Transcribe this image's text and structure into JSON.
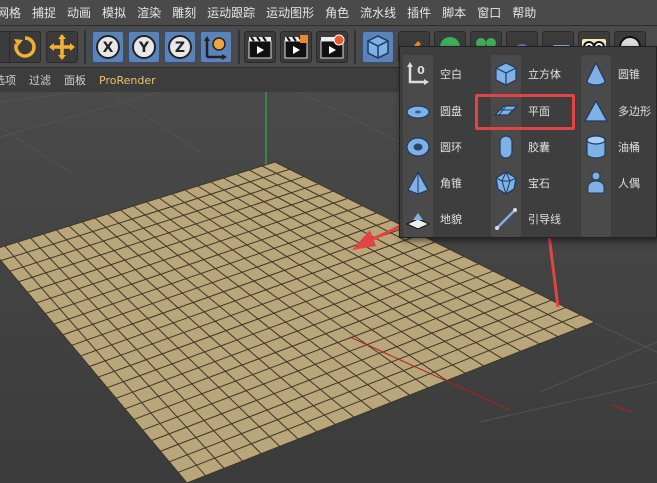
{
  "menu": [
    "网格",
    "捕捉",
    "动画",
    "模拟",
    "渲染",
    "雕刻",
    "运动跟踪",
    "运动图形",
    "角色",
    "流水线",
    "插件",
    "脚本",
    "窗口",
    "帮助"
  ],
  "viewport_menu": [
    "选项",
    "过滤",
    "面板",
    "ProRender"
  ],
  "toolbar": {
    "icons": [
      "rotate-icon",
      "move-icon",
      "x-axis-icon",
      "y-axis-icon",
      "z-axis-icon",
      "world-coordinate-icon",
      "render-view-icon",
      "render-picture-viewer-icon",
      "render-settings-icon",
      "cube-icon",
      "pen-icon",
      "subdivision-icon",
      "cloner-icon",
      "deformer-icon",
      "scene-icon",
      "camera-icon",
      "light-icon"
    ],
    "axis_x": "X",
    "axis_y": "Y",
    "axis_z": "Z"
  },
  "panel": {
    "columns": [
      [
        {
          "label": "空白",
          "icon": "null-object-icon"
        },
        {
          "label": "圆盘",
          "icon": "disc-icon"
        },
        {
          "label": "圆环",
          "icon": "torus-icon"
        },
        {
          "label": "角锥",
          "icon": "pyramid-icon"
        },
        {
          "label": "地貌",
          "icon": "landscape-icon"
        }
      ],
      [
        {
          "label": "立方体",
          "icon": "cube-icon"
        },
        {
          "label": "平面",
          "icon": "plane-icon"
        },
        {
          "label": "胶囊",
          "icon": "capsule-icon"
        },
        {
          "label": "宝石",
          "icon": "gem-icon"
        },
        {
          "label": "引导线",
          "icon": "guide-icon"
        }
      ],
      [
        {
          "label": "圆锥",
          "icon": "cone-icon"
        },
        {
          "label": "多边形",
          "icon": "polygon-icon"
        },
        {
          "label": "油桶",
          "icon": "oil-tank-icon"
        },
        {
          "label": "人偶",
          "icon": "figure-icon"
        }
      ]
    ],
    "highlighted": "平面"
  },
  "colors": {
    "plane": "#b9a67a",
    "grid_line": "#3e3524",
    "accent_blue": "#5b83b9",
    "annotation_red": "#e24444"
  }
}
